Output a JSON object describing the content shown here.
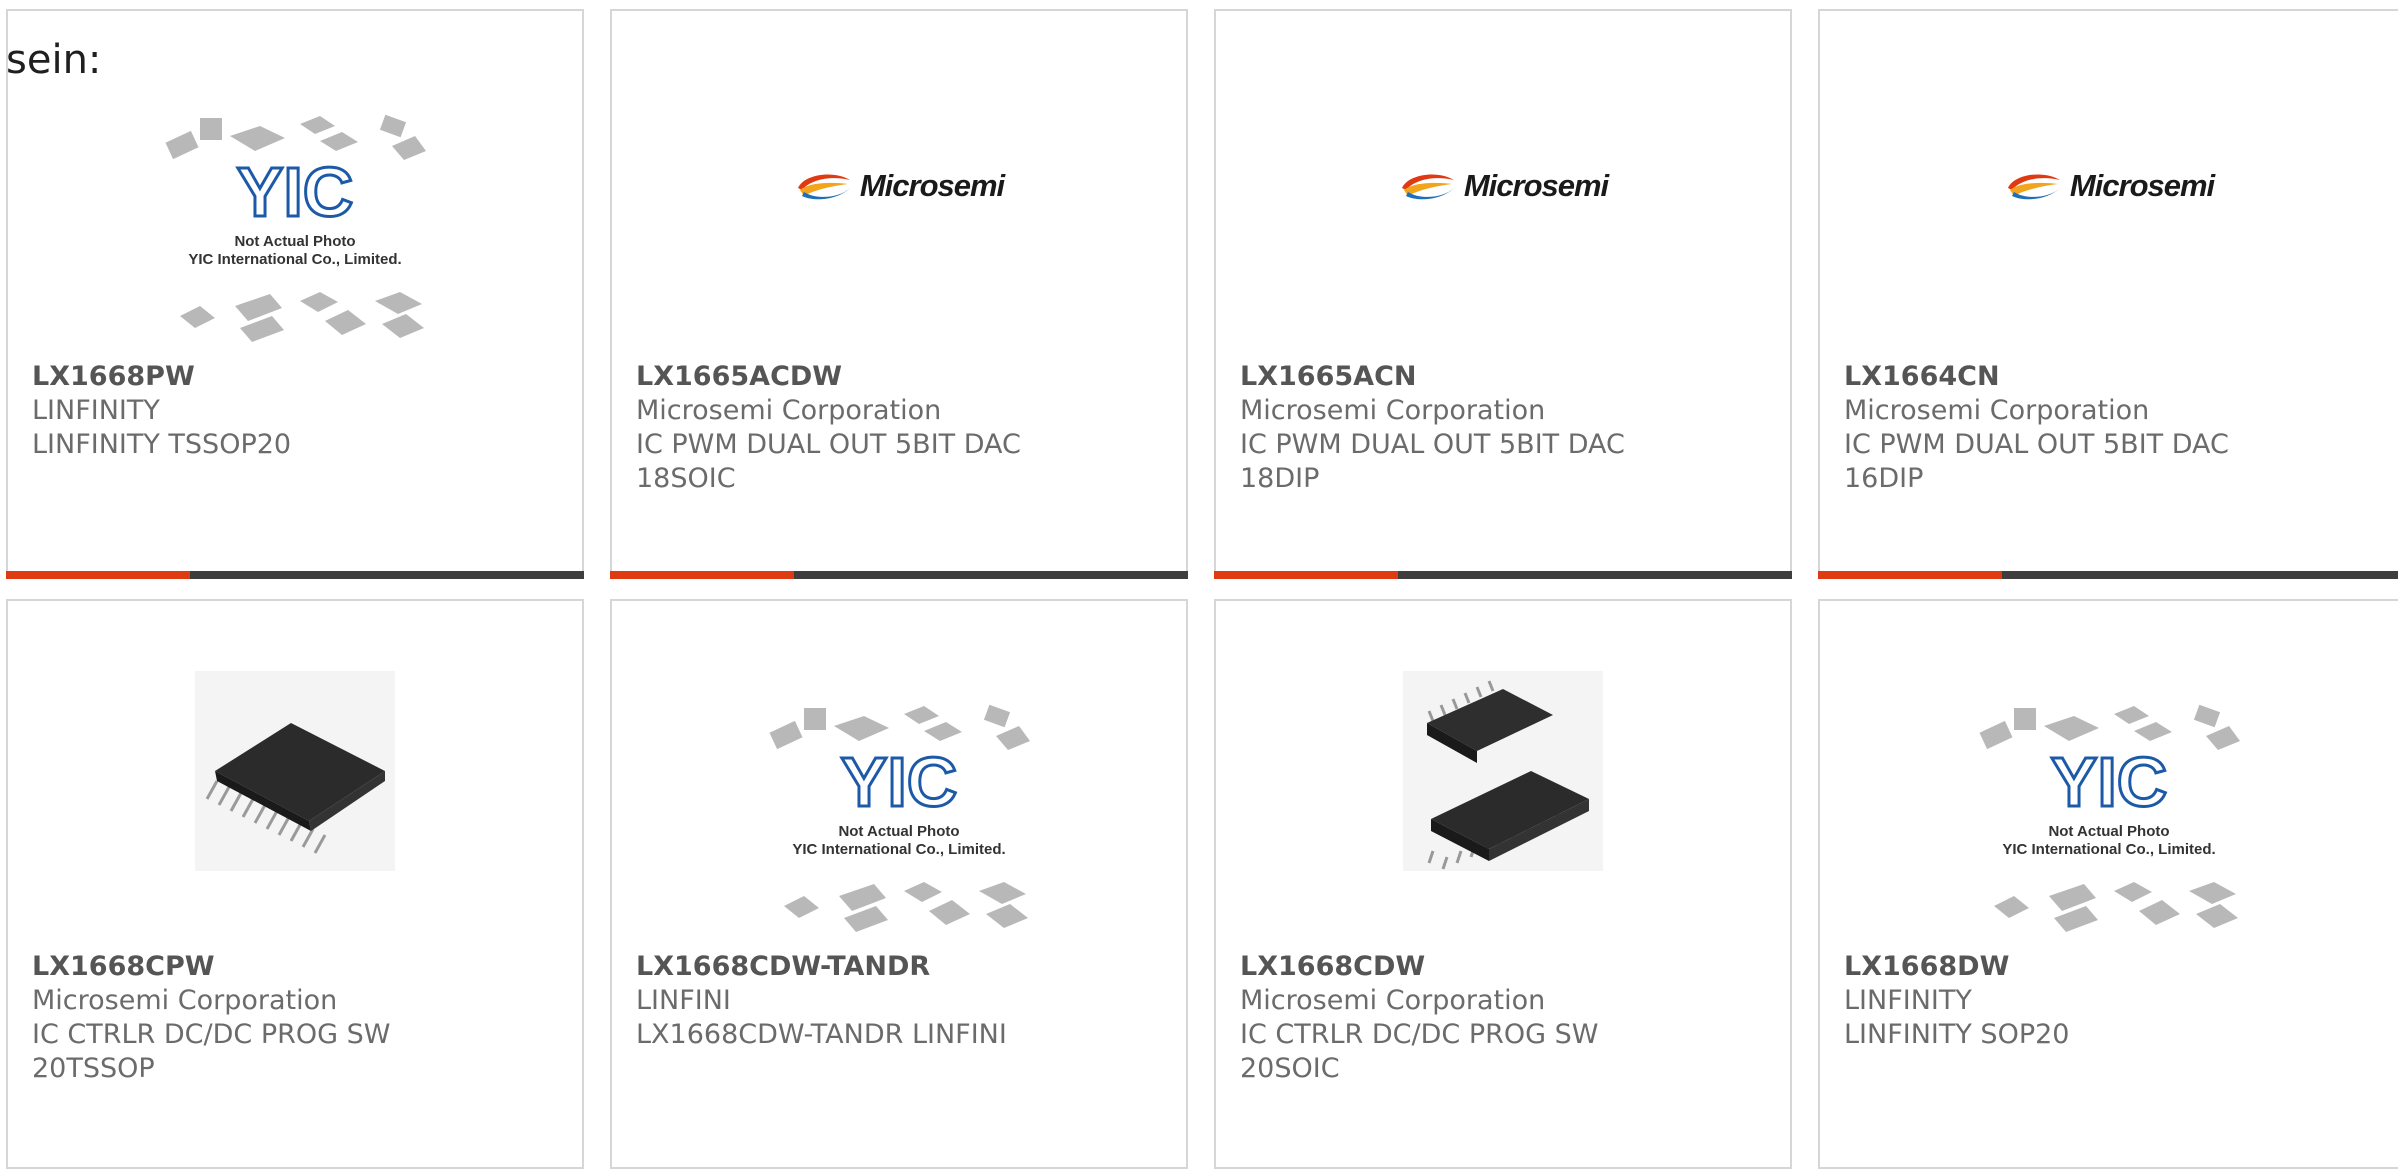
{
  "intro_text": "sein:",
  "logo_text": "Microsemi",
  "placeholder": {
    "line1": "Not Actual Photo",
    "line2": "YIC International Co., Limited.",
    "mark": "YIC"
  },
  "colors": {
    "accent": "#e03a13",
    "bar_dark": "#3e3e3e",
    "border": "#d6d6d6",
    "text": "#6b6b6b"
  },
  "products": [
    {
      "part": "LX1668PW",
      "maker": "LINFINITY",
      "desc": "LINFINITY TSSOP20",
      "image": "not-actual-photo"
    },
    {
      "part": "LX1665ACDW",
      "maker": "Microsemi Corporation",
      "desc": "IC PWM DUAL OUT 5BIT DAC\n18SOIC",
      "image": "microsemi-logo"
    },
    {
      "part": "LX1665ACN",
      "maker": "Microsemi Corporation",
      "desc": "IC PWM DUAL OUT 5BIT DAC\n18DIP",
      "image": "microsemi-logo"
    },
    {
      "part": "LX1664CN",
      "maker": "Microsemi Corporation",
      "desc": "IC PWM DUAL OUT 5BIT DAC\n16DIP",
      "image": "microsemi-logo"
    },
    {
      "part": "LX1668CPW",
      "maker": "Microsemi Corporation",
      "desc": "IC CTRLR DC/DC PROG SW\n20TSSOP",
      "image": "tssop-chip"
    },
    {
      "part": "LX1668CDW-TANDR",
      "maker": "LINFINI",
      "desc": "LX1668CDW-TANDR LINFINI",
      "image": "not-actual-photo"
    },
    {
      "part": "LX1668CDW",
      "maker": "Microsemi Corporation",
      "desc": "IC CTRLR DC/DC PROG SW\n20SOIC",
      "image": "soic-chips"
    },
    {
      "part": "LX1668DW",
      "maker": "LINFINITY",
      "desc": "LINFINITY SOP20",
      "image": "not-actual-photo"
    }
  ]
}
